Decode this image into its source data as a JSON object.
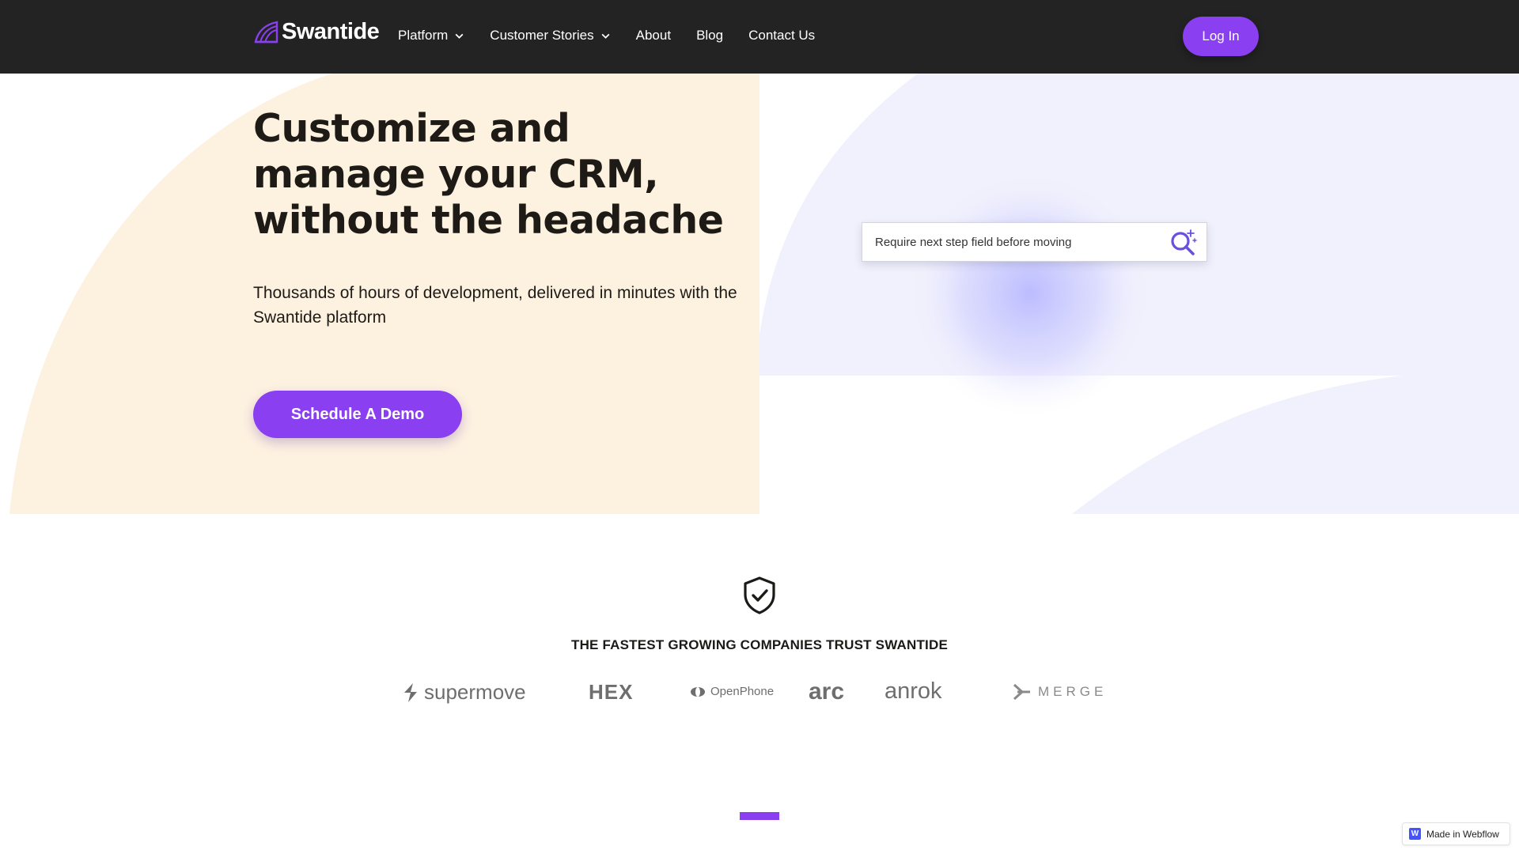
{
  "brand": {
    "name": "Swantide",
    "accent": "#8a3ff0",
    "nav_bg": "#232323",
    "hero_left_bg": "#fdf1e0",
    "hero_right_bg": "#f1f1fd"
  },
  "nav": {
    "items": [
      {
        "label": "Platform",
        "has_dropdown": true
      },
      {
        "label": "Customer Stories",
        "has_dropdown": true
      },
      {
        "label": "About",
        "has_dropdown": false
      },
      {
        "label": "Blog",
        "has_dropdown": false
      },
      {
        "label": "Contact Us",
        "has_dropdown": false
      }
    ],
    "login_label": "Log In"
  },
  "hero": {
    "headline": "Customize and manage your CRM, without the headache",
    "subhead": "Thousands of hours of development, delivered in minutes with the Swantide platform",
    "cta_label": "Schedule A Demo",
    "search_value": "Require next step field before moving",
    "search_icon": "magnify-sparkle-icon"
  },
  "trust": {
    "icon": "shield-check-icon",
    "title": "THE FASTEST GROWING COMPANIES TRUST SWANTIDE",
    "logos": [
      "supermove",
      "HEX",
      "OpenPhone",
      "arc",
      "anrok",
      "MERGE"
    ]
  },
  "badge": {
    "label": "Made in Webflow"
  }
}
